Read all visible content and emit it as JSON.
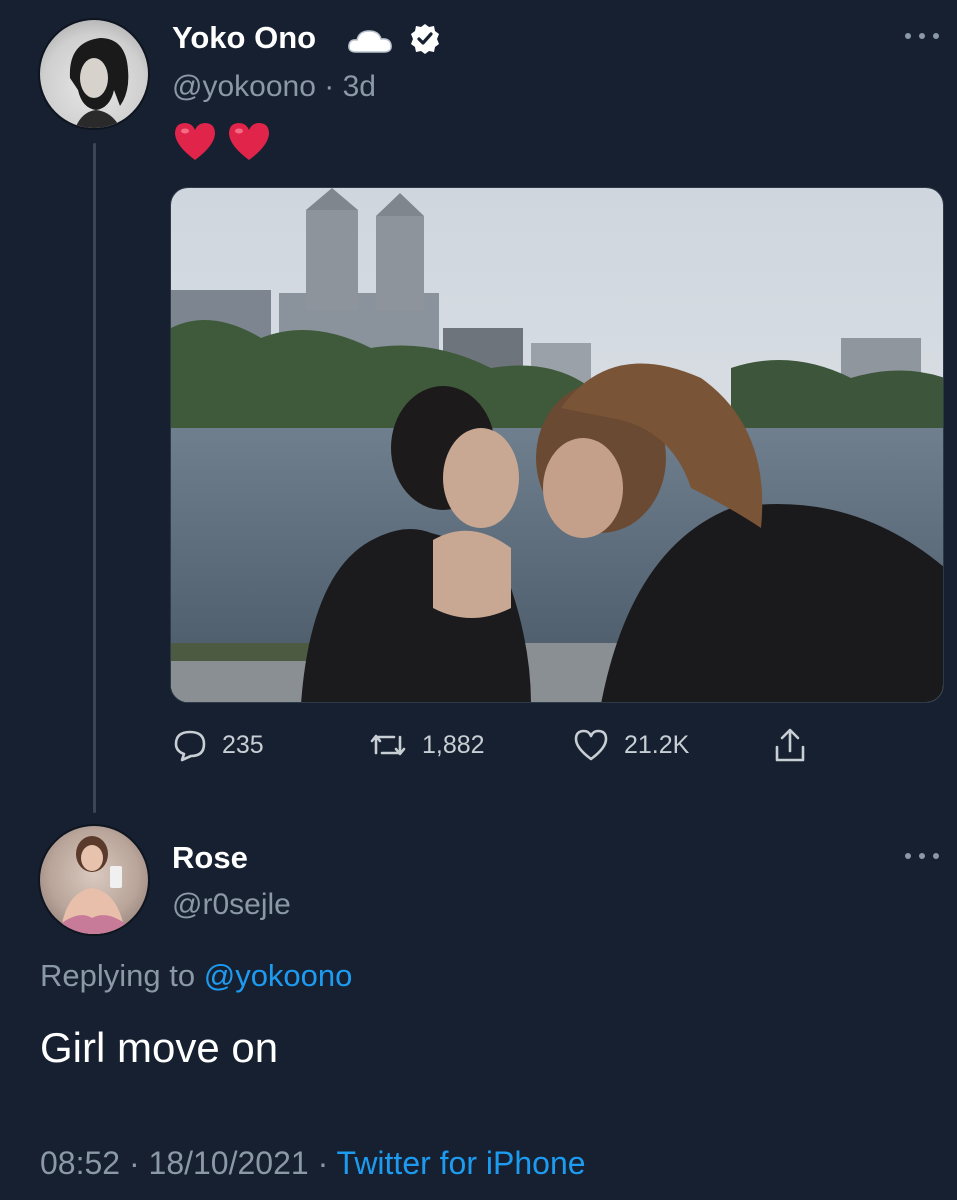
{
  "original_tweet": {
    "author": {
      "name": "Yoko Ono",
      "handle": "@yokoono",
      "time_ago": "3d",
      "badges": [
        "cloud-icon",
        "verified-badge-icon"
      ]
    },
    "text_emoji": [
      "heart-icon",
      "heart-icon"
    ],
    "image_icon": "photo-couple-kissing-by-lake",
    "actions": {
      "replies": "235",
      "retweets": "1,882",
      "likes": "21.2K"
    }
  },
  "reply_tweet": {
    "author": {
      "name": "Rose",
      "handle": "@r0sejle"
    },
    "replying_prefix": "Replying to",
    "replying_to": "@yokoono",
    "text": "Girl move on",
    "time": "08:52",
    "date": "18/10/2021",
    "source": "Twitter for iPhone"
  },
  "colors": {
    "background": "#162030",
    "primary_text": "#ffffff",
    "secondary_text": "#8b98a5",
    "link": "#1d9bf0",
    "heart": "#e0244a"
  }
}
